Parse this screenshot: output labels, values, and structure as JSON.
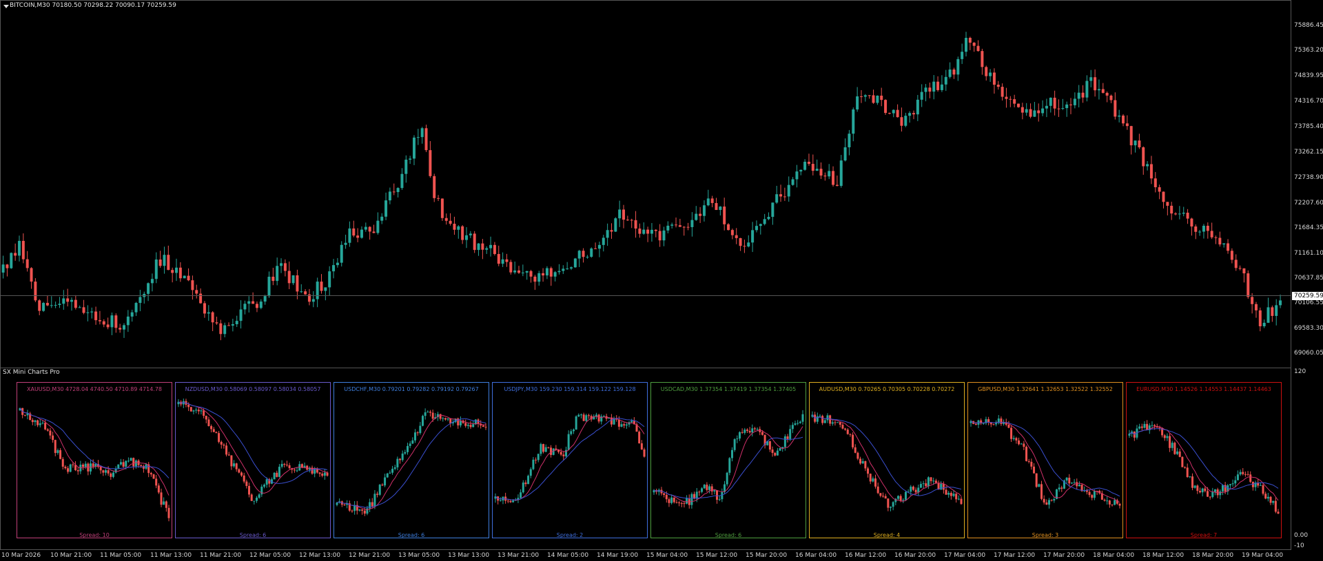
{
  "main_chart": {
    "title": "BITCOIN,M30  70180.50 70298.22 70090.17 70259.59",
    "current_price": "70259.59",
    "up_color": "#26a69a",
    "down_color": "#ef5350",
    "price_ticks": [
      "75886.45",
      "75363.20",
      "74839.95",
      "74316.70",
      "73785.40",
      "73262.15",
      "72738.90",
      "72207.60",
      "71684.35",
      "71161.10",
      "70637.85",
      "70106.55",
      "69583.30",
      "69060.05"
    ]
  },
  "indicator": {
    "title": "SX Mini Charts Pro",
    "scale_ticks": [
      "120",
      "0.00",
      "-10"
    ]
  },
  "time_axis": [
    "10 Mar 2026",
    "10 Mar 21:00",
    "11 Mar 05:00",
    "11 Mar 13:00",
    "11 Mar 21:00",
    "12 Mar 05:00",
    "12 Mar 13:00",
    "12 Mar 21:00",
    "13 Mar 05:00",
    "13 Mar 13:00",
    "13 Mar 21:00",
    "14 Mar 05:00",
    "14 Mar 19:00",
    "15 Mar 04:00",
    "15 Mar 12:00",
    "15 Mar 20:00",
    "16 Mar 04:00",
    "16 Mar 12:00",
    "16 Mar 20:00",
    "17 Mar 04:00",
    "17 Mar 12:00",
    "17 Mar 20:00",
    "18 Mar 04:00",
    "18 Mar 12:00",
    "18 Mar 20:00",
    "19 Mar 04:00"
  ],
  "mini_charts": [
    {
      "title": "XAUUSD,M30 4728.04 4740.50 4710.89 4714.78",
      "spread": "Spread: 10",
      "color": "#c2407a"
    },
    {
      "title": "NZDUSD,M30 0.58069 0.58097 0.58034 0.58057",
      "spread": "Spread: 6",
      "color": "#6a5acd"
    },
    {
      "title": "USDCHF,M30 0.79201 0.79282 0.79192 0.79267",
      "spread": "Spread: 6",
      "color": "#3f7fdf"
    },
    {
      "title": "USDJPY,M30 159.230 159.314 159.122 159.128",
      "spread": "Spread: 2",
      "color": "#3f6fdf"
    },
    {
      "title": "USDCAD,M30 1.37354 1.37419 1.37354 1.37405",
      "spread": "Spread: 6",
      "color": "#4f9f3f"
    },
    {
      "title": "AUDUSD,M30 0.70265 0.70305 0.70228 0.70272",
      "spread": "Spread: 4",
      "color": "#e0b020"
    },
    {
      "title": "GBPUSD,M30 1.32641 1.32653 1.32522 1.32552",
      "spread": "Spread: 3",
      "color": "#e09020"
    },
    {
      "title": "EURUSD,M30 1.14526 1.14553 1.14437 1.14463",
      "spread": "Spread: 7",
      "color": "#d01010"
    }
  ]
}
